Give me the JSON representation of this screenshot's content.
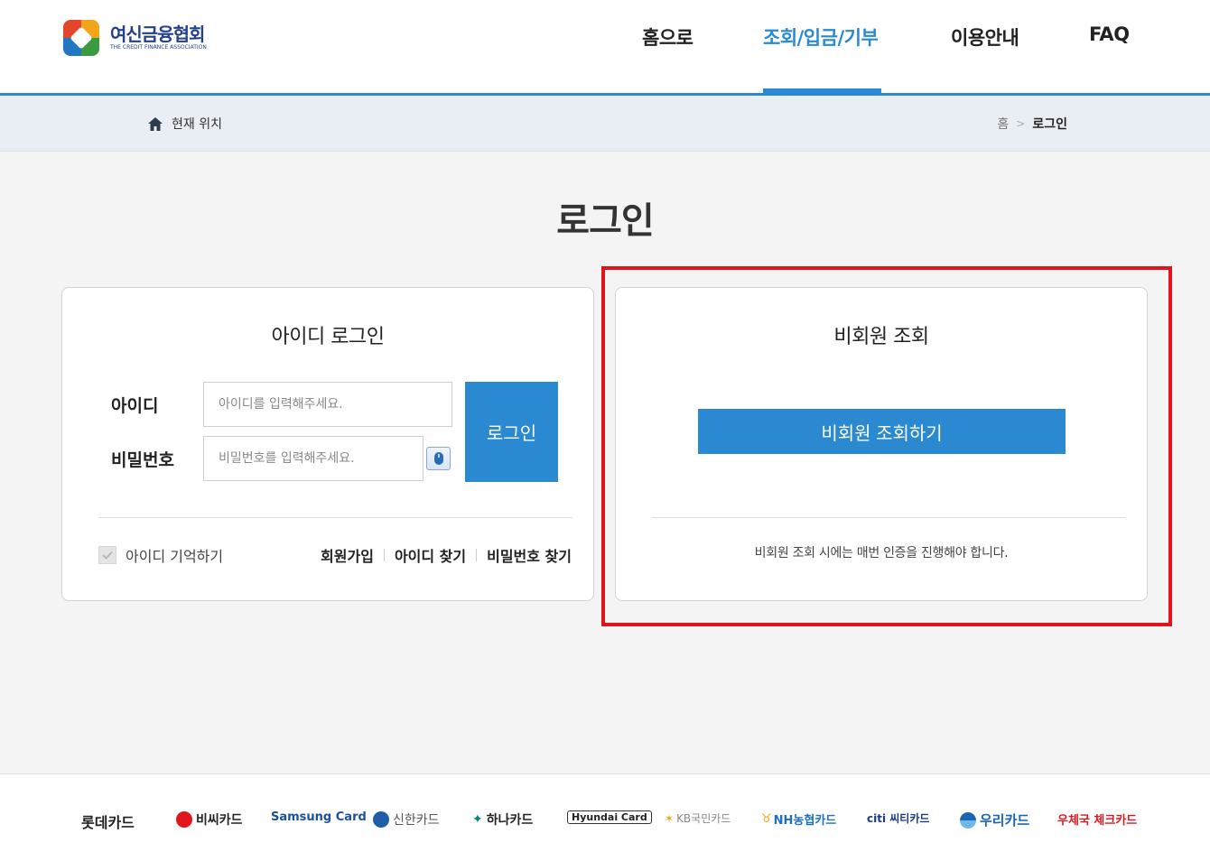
{
  "header": {
    "logo_ko": "여신금융협회",
    "logo_en": "THE CREDIT FINANCE ASSOCIATION",
    "nav": [
      {
        "label": "홈으로",
        "active": false
      },
      {
        "label": "조회/입금/기부",
        "active": true
      },
      {
        "label": "이용안내",
        "active": false
      },
      {
        "label": "FAQ",
        "active": false
      }
    ]
  },
  "breadcrumb": {
    "location_label": "현재 위치",
    "home": "홈",
    "separator": ">",
    "current": "로그인"
  },
  "page_title": "로그인",
  "id_login": {
    "title": "아이디 로그인",
    "id_label": "아이디",
    "id_placeholder": "아이디를 입력해주세요.",
    "pw_label": "비밀번호",
    "pw_placeholder": "비밀번호를 입력해주세요.",
    "login_button": "로그인",
    "remember_label": "아이디 기억하기",
    "links": [
      "회원가입",
      "아이디 찾기",
      "비밀번호 찾기"
    ]
  },
  "guest": {
    "title": "비회원 조회",
    "button": "비회원 조회하기",
    "note": "비회원 조회 시에는 매번 인증을 진행해야 합니다."
  },
  "footer": {
    "cards": [
      {
        "name": "롯데카드",
        "color": "#222222"
      },
      {
        "name": "비씨카드",
        "color": "#e1141b"
      },
      {
        "name": "Samsung Card",
        "color": "#1d4fa1"
      },
      {
        "name": "신한카드",
        "color": "#555555"
      },
      {
        "name": "하나카드",
        "color": "#008485"
      },
      {
        "name": "Hyundai Card",
        "color": "#222222"
      },
      {
        "name": "KB국민카드",
        "color": "#8a8a8a"
      },
      {
        "name": "NH농협카드",
        "color": "#1f6fc0"
      },
      {
        "name": "citi 씨티카드",
        "color": "#1b3a8c"
      },
      {
        "name": "우리카드",
        "color": "#1a66b3"
      },
      {
        "name": "우체국 체크카드",
        "color": "#d71920"
      }
    ]
  },
  "colors": {
    "accent": "#2a89d0",
    "highlight": "#e1141b"
  }
}
